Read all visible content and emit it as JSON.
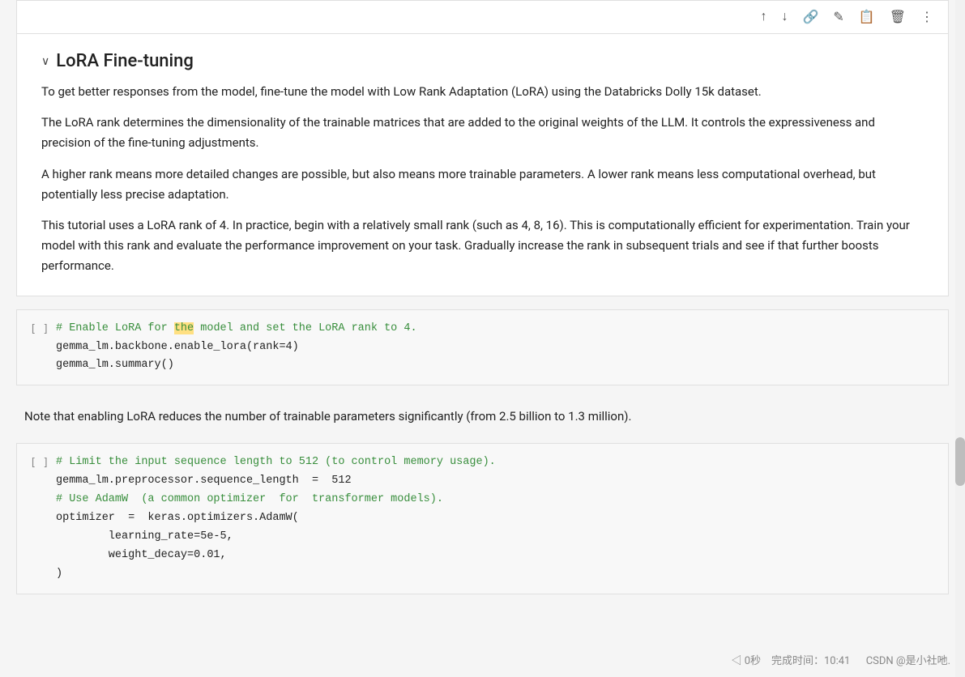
{
  "toolbar": {
    "buttons": [
      "↑",
      "↓",
      "🔗",
      "✏️",
      "⎘",
      "🗑",
      "⋮"
    ]
  },
  "section": {
    "chevron": "∨",
    "title": "LoRA Fine-tuning",
    "paragraphs": [
      "To get better responses from the model, fine-tune the model with Low Rank Adaptation (LoRA) using the Databricks Dolly 15k dataset.",
      "The LoRA rank determines the dimensionality of the trainable matrices that are added to the original weights of the LLM. It controls the expressiveness and precision of the fine-tuning adjustments.",
      "A higher rank means more detailed changes are possible, but also means more trainable parameters. A lower rank means less computational overhead, but potentially less precise adaptation.",
      "This tutorial uses a LoRA rank of 4. In practice, begin with a relatively small rank (such as 4, 8, 16). This is computationally efficient for experimentation. Train your model with this rank and evaluate the performance improvement on your task. Gradually increase the rank in subsequent trials and see if that further boosts performance."
    ]
  },
  "code_cell_1": {
    "counter": "[ ]",
    "lines": [
      {
        "type": "comment",
        "text": "# Enable LoRA for the model and set the LoRA rank to 4."
      },
      {
        "type": "code",
        "text": "gemma_lm.backbone.enable_lora(rank=4)"
      },
      {
        "type": "code",
        "text": "gemma_lm.summary()"
      }
    ]
  },
  "note": "Note that enabling LoRA reduces the number of trainable parameters significantly (from 2.5 billion to 1.3 million).",
  "code_cell_2": {
    "counter": "[ ]",
    "lines": [
      {
        "type": "comment",
        "text": "# Limit the input sequence length to 512 (to control memory usage)."
      },
      {
        "type": "code",
        "text": "gemma_lm.preprocessor.sequence_length  =  512"
      },
      {
        "type": "comment",
        "text": "# Use AdamW  (a common optimizer  for  transformer models)."
      },
      {
        "type": "code",
        "text": "optimizer  =  keras.optimizers.AdamW("
      },
      {
        "type": "code",
        "text": "        learning_rate=5e-5,"
      },
      {
        "type": "code",
        "text": "        weight_decay=0.01,"
      },
      {
        "type": "code",
        "text": ")"
      }
    ]
  },
  "footer": {
    "timer": "◁ 0秒",
    "time_label": "完成时间：10:41",
    "watermark": "CSDN @是小社吔."
  }
}
